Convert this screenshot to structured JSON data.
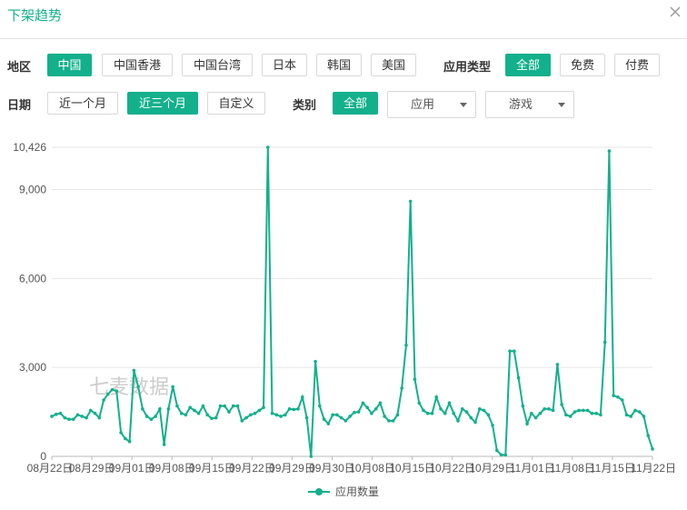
{
  "header": {
    "title": "下架趋势"
  },
  "filters": {
    "region_label": "地区",
    "regions": [
      "中国",
      "中国香港",
      "中国台湾",
      "日本",
      "韩国",
      "美国"
    ],
    "region_active": 0,
    "app_type_label": "应用类型",
    "app_types": [
      "全部",
      "免费",
      "付费"
    ],
    "app_type_active": 0,
    "date_label": "日期",
    "dates": [
      "近一个月",
      "近三个月",
      "自定义"
    ],
    "date_active": 1,
    "category_label": "类别",
    "category_all": "全部",
    "category_select_1": "应用",
    "category_select_2": "游戏"
  },
  "chart_data": {
    "type": "line",
    "watermark": "七麦数据",
    "legend": "应用数量",
    "color": "#13b08c",
    "ylim": [
      0,
      10426
    ],
    "yticks": [
      0,
      3000,
      6000,
      9000,
      10426
    ],
    "ytick_labels": [
      "0",
      "3,000",
      "6,000",
      "9,000",
      "10,426"
    ],
    "xtick_labels": [
      "08月22日",
      "08月29日",
      "09月01日",
      "09月08日",
      "09月15日",
      "09月22日",
      "09月29日",
      "09月30日",
      "10月08日",
      "10月15日",
      "10月22日",
      "10月29日",
      "11月01日",
      "11月08日",
      "11月15日",
      "11月22日"
    ],
    "x_start": "08-22",
    "x_end": "11-22",
    "values": [
      1350,
      1420,
      1450,
      1300,
      1250,
      1250,
      1400,
      1350,
      1300,
      1550,
      1450,
      1300,
      1900,
      2100,
      2250,
      2200,
      800,
      600,
      500,
      2900,
      2350,
      1600,
      1350,
      1250,
      1350,
      1600,
      400,
      1600,
      2350,
      1700,
      1450,
      1400,
      1650,
      1550,
      1450,
      1700,
      1400,
      1280,
      1300,
      1700,
      1700,
      1500,
      1700,
      1700,
      1200,
      1300,
      1400,
      1450,
      1550,
      1650,
      10426,
      1450,
      1400,
      1350,
      1400,
      1600,
      1580,
      1600,
      2000,
      1300,
      0,
      3200,
      1700,
      1250,
      1100,
      1400,
      1400,
      1300,
      1200,
      1350,
      1480,
      1500,
      1800,
      1650,
      1450,
      1600,
      1800,
      1350,
      1200,
      1200,
      1400,
      2300,
      3750,
      8600,
      2600,
      1800,
      1550,
      1450,
      1450,
      2000,
      1600,
      1450,
      1800,
      1450,
      1200,
      1600,
      1500,
      1300,
      1150,
      1600,
      1550,
      1400,
      1050,
      200,
      50,
      50,
      3550,
      3550,
      2650,
      1700,
      1100,
      1450,
      1300,
      1450,
      1600,
      1600,
      1550,
      3100,
      1750,
      1400,
      1350,
      1500,
      1550,
      1550,
      1550,
      1450,
      1450,
      1400,
      3850,
      10300,
      2050,
      2000,
      1900,
      1400,
      1350,
      1550,
      1500,
      1350,
      700,
      250
    ]
  }
}
